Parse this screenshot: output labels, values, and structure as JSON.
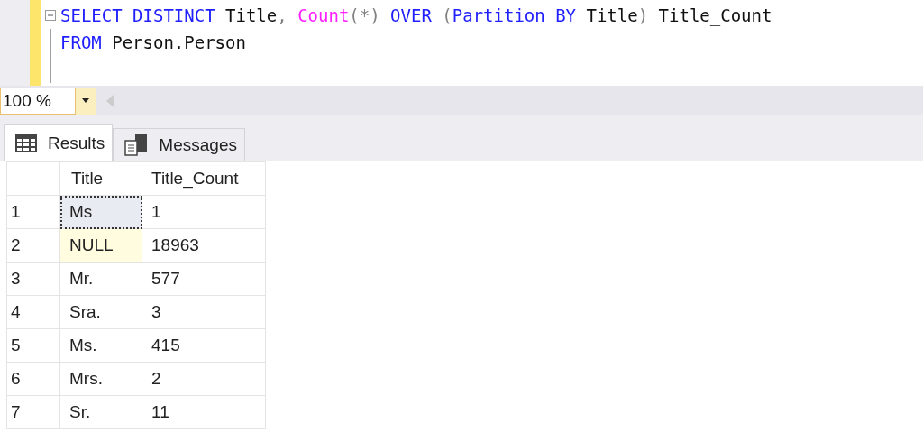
{
  "editor": {
    "lines": [
      {
        "collapsible": true,
        "tokens": [
          {
            "text": "SELECT DISTINCT ",
            "kind": "keyword"
          },
          {
            "text": "Title",
            "kind": "plain"
          },
          {
            "text": ", ",
            "kind": "operator"
          },
          {
            "text": "Count",
            "kind": "function"
          },
          {
            "text": "(*) ",
            "kind": "operator"
          },
          {
            "text": "OVER ",
            "kind": "keyword"
          },
          {
            "text": "(",
            "kind": "operator"
          },
          {
            "text": "Partition BY ",
            "kind": "keyword"
          },
          {
            "text": "Title",
            "kind": "plain"
          },
          {
            "text": ") ",
            "kind": "operator"
          },
          {
            "text": "Title_Count",
            "kind": "plain"
          }
        ]
      },
      {
        "collapsible": false,
        "tokens": [
          {
            "text": "FROM ",
            "kind": "keyword"
          },
          {
            "text": "Person.Person",
            "kind": "plain"
          }
        ]
      }
    ]
  },
  "zoom": {
    "value": "100 %"
  },
  "tabs": [
    {
      "label": "Results",
      "selected": true
    },
    {
      "label": "Messages",
      "selected": false
    }
  ],
  "grid": {
    "columns": [
      "Title",
      "Title_Count"
    ],
    "rows": [
      {
        "number": "1",
        "title": {
          "text": "Ms",
          "focused": true,
          "null": false
        },
        "count": "1"
      },
      {
        "number": "2",
        "title": {
          "text": "NULL",
          "focused": false,
          "null": true
        },
        "count": "18963"
      },
      {
        "number": "3",
        "title": {
          "text": "Mr.",
          "focused": false,
          "null": false
        },
        "count": "577"
      },
      {
        "number": "4",
        "title": {
          "text": "Sra.",
          "focused": false,
          "null": false
        },
        "count": "3"
      },
      {
        "number": "5",
        "title": {
          "text": "Ms.",
          "focused": false,
          "null": false
        },
        "count": "415"
      },
      {
        "number": "6",
        "title": {
          "text": "Mrs.",
          "focused": false,
          "null": false
        },
        "count": "2"
      },
      {
        "number": "7",
        "title": {
          "text": "Sr.",
          "focused": false,
          "null": false
        },
        "count": "11"
      }
    ]
  }
}
